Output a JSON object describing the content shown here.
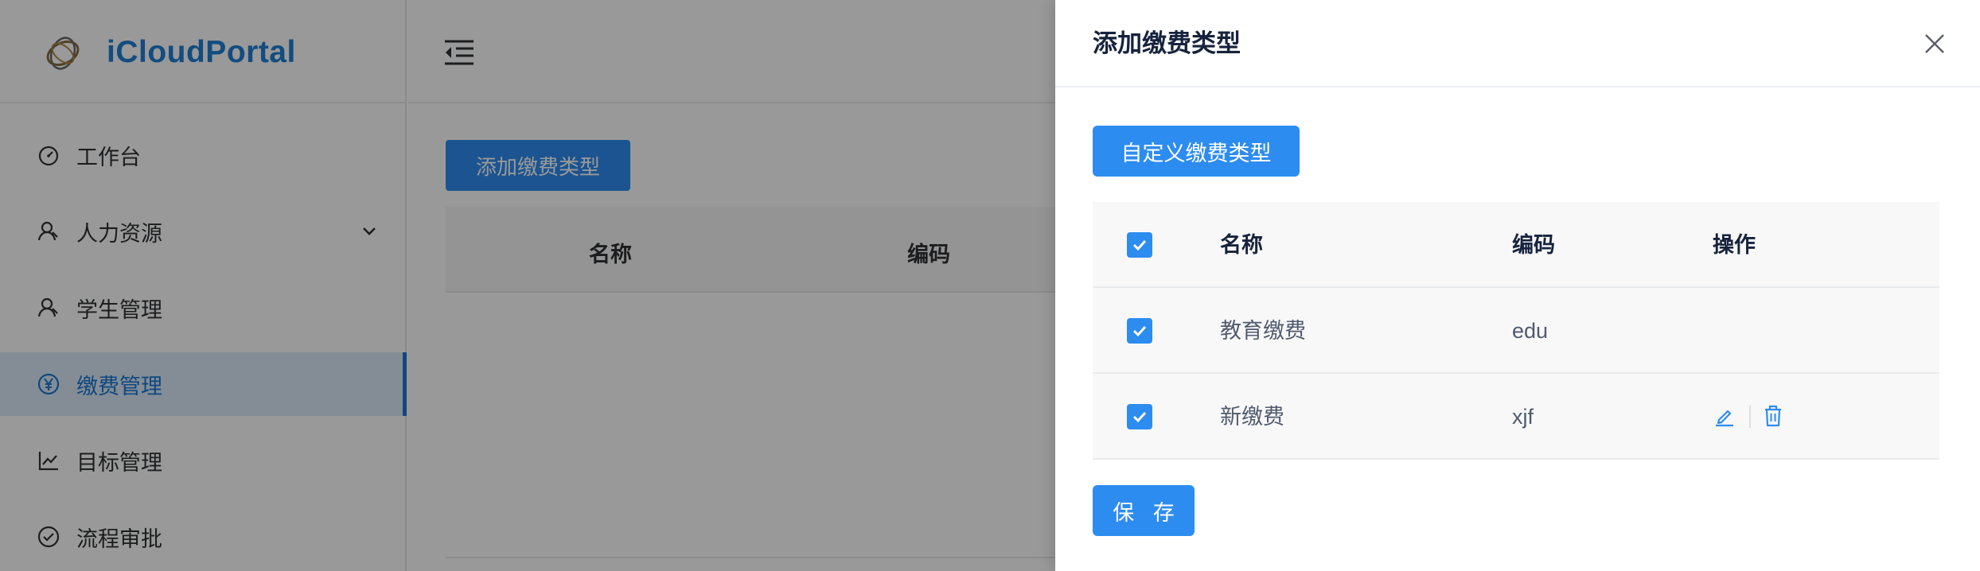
{
  "app": {
    "name": "iCloudPortal"
  },
  "sidebar": {
    "items": [
      {
        "label": "工作台",
        "icon": "dashboard-icon",
        "active": false
      },
      {
        "label": "人力资源",
        "icon": "user-icon",
        "active": false,
        "expandable": true
      },
      {
        "label": "学生管理",
        "icon": "user-icon",
        "active": false
      },
      {
        "label": "缴费管理",
        "icon": "yen-icon",
        "active": true
      },
      {
        "label": "目标管理",
        "icon": "line-chart-icon",
        "active": false
      },
      {
        "label": "流程审批",
        "icon": "check-circle-icon",
        "active": false
      }
    ]
  },
  "main": {
    "add_button": "添加缴费类型",
    "table": {
      "columns": [
        "名称",
        "编码"
      ]
    }
  },
  "drawer": {
    "title": "添加缴费类型",
    "custom_button": "自定义缴费类型",
    "table": {
      "columns": {
        "name": "名称",
        "code": "编码",
        "op": "操作"
      },
      "rows": [
        {
          "name": "教育缴费",
          "code": "edu",
          "checked": true,
          "editable": false
        },
        {
          "name": "新缴费",
          "code": "xjf",
          "checked": true,
          "editable": true
        }
      ]
    },
    "save_button": "保 存"
  },
  "colors": {
    "primary": "#2d8cf0",
    "brand_text": "#1f7fd6",
    "active_menu_bg": "#dcebf9",
    "mask": "rgba(0,0,0,0.40)"
  }
}
